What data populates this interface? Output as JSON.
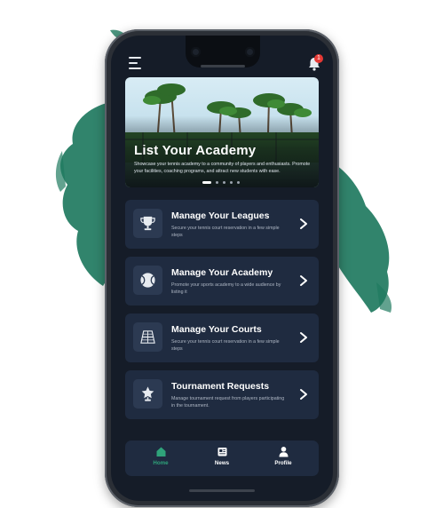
{
  "notification": {
    "badge_count": "1"
  },
  "hero": {
    "title": "List Your Academy",
    "description": "Showcase your tennis academy to a community of players and enthusiasts. Promote your facilities, coaching programs, and attract new students with ease.",
    "slide_count": 5,
    "active_slide": 1
  },
  "cards": [
    {
      "title": "Manage Your Leagues",
      "description": "Secure your tennis court reservation in a few simple steps",
      "icon": "trophy-icon"
    },
    {
      "title": "Manage Your Academy",
      "description": "Promote your sports academy to a wide audience by listing it",
      "icon": "tennis-ball-icon"
    },
    {
      "title": "Manage Your Courts",
      "description": "Secure your tennis court reservation in a few simple steps",
      "icon": "tennis-court-icon"
    },
    {
      "title": "Tournament Requests",
      "description": "Manage tournament request from players participating in the tournament.",
      "icon": "star-trophy-icon"
    }
  ],
  "bottom_nav": [
    {
      "label": "Home",
      "icon": "home-icon",
      "active": true
    },
    {
      "label": "News",
      "icon": "news-icon",
      "active": false
    },
    {
      "label": "Profile",
      "icon": "profile-icon",
      "active": false
    }
  ],
  "colors": {
    "screen_bg": "#151c28",
    "card_bg": "#1f2b40",
    "accent": "#2fa37a",
    "splash": "#1f7a5f",
    "badge": "#e53935"
  }
}
